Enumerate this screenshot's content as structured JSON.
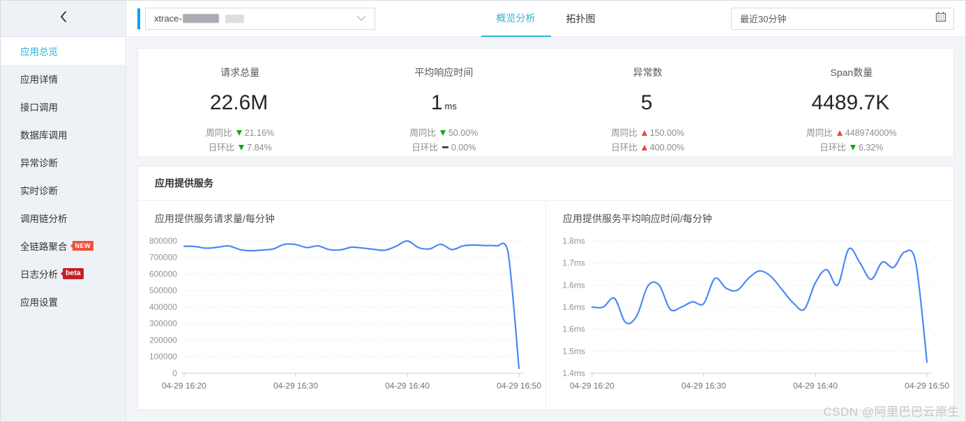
{
  "sidebar": {
    "collapse_icon": "chevron-left",
    "items": [
      {
        "label": "应用总览",
        "active": true
      },
      {
        "label": "应用详情",
        "active": false
      },
      {
        "label": "接口调用",
        "active": false
      },
      {
        "label": "数据库调用",
        "active": false
      },
      {
        "label": "异常诊断",
        "active": false
      },
      {
        "label": "实时诊断",
        "active": false
      },
      {
        "label": "调用链分析",
        "active": false
      },
      {
        "label": "全链路聚合",
        "active": false,
        "badge": "NEW"
      },
      {
        "label": "日志分析",
        "active": false,
        "badge": "beta"
      },
      {
        "label": "应用设置",
        "active": false
      }
    ]
  },
  "topbar": {
    "app_select": {
      "value": "xtrace-",
      "redacted": true,
      "icon": "chevron-down"
    },
    "tabs": [
      {
        "label": "概览分析",
        "active": true
      },
      {
        "label": "拓扑图",
        "active": false
      }
    ],
    "time_picker": {
      "value": "最近30分钟",
      "icon": "calendar"
    }
  },
  "metrics": [
    {
      "label": "请求总量",
      "value": "22.6M",
      "unit": "",
      "wow_label": "周同比",
      "wow_dir": "down",
      "wow_value": "21.16%",
      "dod_label": "日环比",
      "dod_dir": "down",
      "dod_value": "7.84%"
    },
    {
      "label": "平均响应时间",
      "value": "1",
      "unit": "ms",
      "wow_label": "周同比",
      "wow_dir": "down",
      "wow_value": "50.00%",
      "dod_label": "日环比",
      "dod_dir": "flat",
      "dod_value": "0.00%"
    },
    {
      "label": "异常数",
      "value": "5",
      "unit": "",
      "wow_label": "周同比",
      "wow_dir": "up",
      "wow_value": "150.00%",
      "dod_label": "日环比",
      "dod_dir": "up",
      "dod_value": "400.00%"
    },
    {
      "label": "Span数量",
      "value": "4489.7K",
      "unit": "",
      "wow_label": "周同比",
      "wow_dir": "up",
      "wow_value": "448974000%",
      "dod_label": "日环比",
      "dod_dir": "down",
      "dod_value": "6.32%"
    }
  ],
  "section": {
    "title": "应用提供服务"
  },
  "chart_data": [
    {
      "type": "line",
      "title": "应用提供服务请求量/每分钟",
      "interval_minutes": 1,
      "x_total_minutes": 30,
      "x_tick_positions": [
        0,
        10,
        20,
        30
      ],
      "x_tick_labels": [
        "04-29 16:20",
        "04-29 16:30",
        "04-29 16:40",
        "04-29 16:50"
      ],
      "ylim": [
        0,
        800000
      ],
      "y_tick_values": [
        800000,
        700000,
        600000,
        500000,
        400000,
        300000,
        200000,
        100000,
        0
      ],
      "y_tick_labels": [
        "800000",
        "700000",
        "600000",
        "500000",
        "400000",
        "300000",
        "200000",
        "100000",
        "0"
      ],
      "grid": "dashed-horizontal",
      "legend": "none",
      "line_color": "#4d87f5",
      "series": [
        {
          "name": "请求量/每分钟",
          "values": [
            768000,
            766000,
            756000,
            762000,
            770000,
            748000,
            741000,
            745000,
            752000,
            780000,
            778000,
            760000,
            770000,
            748000,
            746000,
            762000,
            757000,
            749000,
            744000,
            768000,
            800000,
            760000,
            752000,
            780000,
            748000,
            770000,
            775000,
            772000,
            770000,
            740000,
            30000
          ]
        }
      ]
    },
    {
      "type": "line",
      "title": "应用提供服务平均响应时间/每分钟",
      "interval_minutes": 1,
      "x_total_minutes": 30,
      "x_tick_positions": [
        0,
        10,
        20,
        30
      ],
      "x_tick_labels": [
        "04-29 16:20",
        "04-29 16:30",
        "04-29 16:40",
        "04-29 16:50"
      ],
      "ylim": [
        1.45,
        1.75
      ],
      "y_tick_values": [
        1.75,
        1.7,
        1.65,
        1.6,
        1.55,
        1.5,
        1.45
      ],
      "y_tick_labels": [
        "1.8ms",
        "1.7ms",
        "1.6ms",
        "1.6ms",
        "1.6ms",
        "1.5ms",
        "1.4ms"
      ],
      "grid": "dashed-horizontal",
      "legend": "none",
      "line_color": "#4d87f5",
      "series": [
        {
          "name": "平均响应时间(ms)/每分钟",
          "values": [
            1.6,
            1.6,
            1.62,
            1.565,
            1.58,
            1.648,
            1.65,
            1.595,
            1.6,
            1.612,
            1.608,
            1.665,
            1.643,
            1.638,
            1.665,
            1.682,
            1.67,
            1.64,
            1.61,
            1.595,
            1.655,
            1.685,
            1.65,
            1.732,
            1.7,
            1.663,
            1.702,
            1.69,
            1.725,
            1.7,
            1.475
          ]
        }
      ]
    }
  ],
  "watermark": "CSDN @阿里巴巴云原生",
  "colors": {
    "accent_cyan": "#2ab6d9",
    "accent_blue_bar": "#0ea0eb",
    "chart_line_blue": "#4d87f5",
    "trend_up_red": "#f04134",
    "trend_down_green": "#0fa80f",
    "badge_new_red": "#f0503c",
    "badge_beta_red": "#c1202a",
    "sidebar_bg": "#eef1f5",
    "content_bg": "#f3f5f8"
  }
}
